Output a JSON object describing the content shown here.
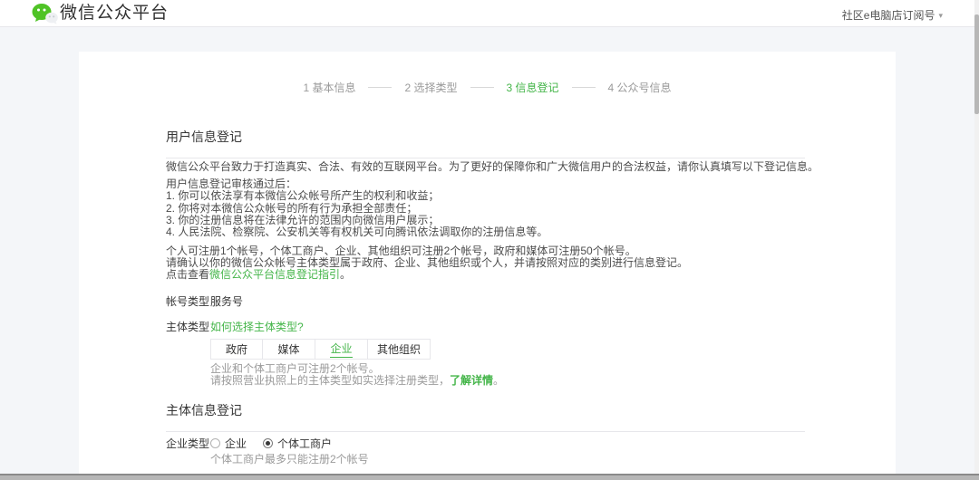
{
  "header": {
    "title": "微信公众平台",
    "account": "社区e电脑店订阅号",
    "caret": "▾"
  },
  "steps": {
    "items": [
      {
        "label": "1 基本信息"
      },
      {
        "label": "2 选择类型"
      },
      {
        "label": "3 信息登记"
      },
      {
        "label": "4 公众号信息"
      }
    ]
  },
  "user_info_section": {
    "heading": "用户信息登记",
    "intro": "微信公众平台致力于打造真实、合法、有效的互联网平台。为了更好的保障你和广大微信用户的合法权益，请你认真填写以下登记信息。",
    "audit_title": "用户信息登记审核通过后：",
    "audit_items": [
      "1. 你可以依法享有本微信公众帐号所产生的权利和收益；",
      "2. 你将对本微信公众帐号的所有行为承担全部责任；",
      "3. 你的注册信息将在法律允许的范围内向微信用户展示；",
      "4. 人民法院、检察院、公安机关等有权机关可向腾讯依法调取你的注册信息等。"
    ],
    "quota_line1": "个人可注册1个帐号，个体工商户、企业、其他组织可注册2个帐号，政府和媒体可注册50个帐号。",
    "quota_line2": "请确认以你的微信公众帐号主体类型属于政府、企业、其他组织或个人，并请按照对应的类别进行信息登记。",
    "guide_prefix": "点击查看",
    "guide_link": "微信公众平台信息登记指引",
    "guide_suffix": "。"
  },
  "account_type": {
    "label": "帐号类型",
    "value": "服务号"
  },
  "subject_type": {
    "label": "主体类型",
    "help_link": "如何选择主体类型?",
    "tabs": [
      {
        "label": "政府"
      },
      {
        "label": "媒体"
      },
      {
        "label": "企业"
      },
      {
        "label": "其他组织"
      }
    ],
    "note1": "企业和个体工商户可注册2个帐号。",
    "note2_prefix": "请按照营业执照上的主体类型如实选择注册类型，",
    "note2_link": "了解详情",
    "note2_suffix": "。"
  },
  "subject_info_section": {
    "heading": "主体信息登记"
  },
  "enterprise_type": {
    "label": "企业类型",
    "options": [
      {
        "label": "企业"
      },
      {
        "label": "个体工商户"
      }
    ],
    "note": "个体工商户最多只能注册2个帐号"
  },
  "colors": {
    "accent_green": "#44b549",
    "muted_text": "#9a9a9a",
    "background": "#f4f6f9"
  }
}
